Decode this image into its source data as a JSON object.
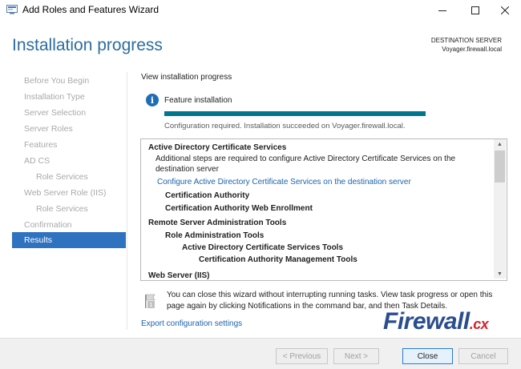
{
  "window": {
    "title": "Add Roles and Features Wizard",
    "icons": {
      "app": "server-manager-icon",
      "minimize": "minimize-icon",
      "maximize": "maximize-icon",
      "close": "close-icon"
    }
  },
  "header": {
    "page_title": "Installation progress",
    "destination_label": "DESTINATION SERVER",
    "destination_value": "Voyager.firewall.local"
  },
  "nav": {
    "items": [
      {
        "label": "Before You Begin",
        "state": "disabled"
      },
      {
        "label": "Installation Type",
        "state": "disabled"
      },
      {
        "label": "Server Selection",
        "state": "disabled"
      },
      {
        "label": "Server Roles",
        "state": "disabled"
      },
      {
        "label": "Features",
        "state": "disabled"
      },
      {
        "label": "AD CS",
        "state": "disabled"
      },
      {
        "label": "Role Services",
        "state": "disabled",
        "indent": true
      },
      {
        "label": "Web Server Role (IIS)",
        "state": "disabled"
      },
      {
        "label": "Role Services",
        "state": "disabled",
        "indent": true
      },
      {
        "label": "Confirmation",
        "state": "disabled"
      },
      {
        "label": "Results",
        "state": "active"
      }
    ]
  },
  "main": {
    "view_label": "View installation progress",
    "feature_label": "Feature installation",
    "progress_fraction": 1.0,
    "status": "Configuration required. Installation succeeded on Voyager.firewall.local.",
    "results": {
      "adcs_title": "Active Directory Certificate Services",
      "adcs_note_line1": "Additional steps are required to configure Active Directory Certificate Services on the",
      "adcs_note_line2": "destination server",
      "adcs_link": "Configure Active Directory Certificate Services on the destination server",
      "adcs_item1": "Certification Authority",
      "adcs_item2": "Certification Authority Web Enrollment",
      "rsat_title": "Remote Server Administration Tools",
      "rsat_role_tools": "Role Administration Tools",
      "rsat_adcs_tools": "Active Directory Certificate Services Tools",
      "rsat_ca_tools": "Certification Authority Management Tools",
      "iis_title": "Web Server (IIS)"
    },
    "hint_line1": "You can close this wizard without interrupting running tasks. View task progress or open this",
    "hint_line2": "page again by clicking Notifications in the command bar, and then Task Details.",
    "export_link": "Export configuration settings"
  },
  "watermark": {
    "brand": "Firewall",
    "tld": ".cx"
  },
  "buttons": {
    "previous": "< Previous",
    "next": "Next >",
    "close": "Close",
    "cancel": "Cancel"
  },
  "colors": {
    "title_blue": "#2d6d9f",
    "nav_active": "#2f73c0",
    "progress": "#00768f",
    "link": "#1b64aa"
  }
}
